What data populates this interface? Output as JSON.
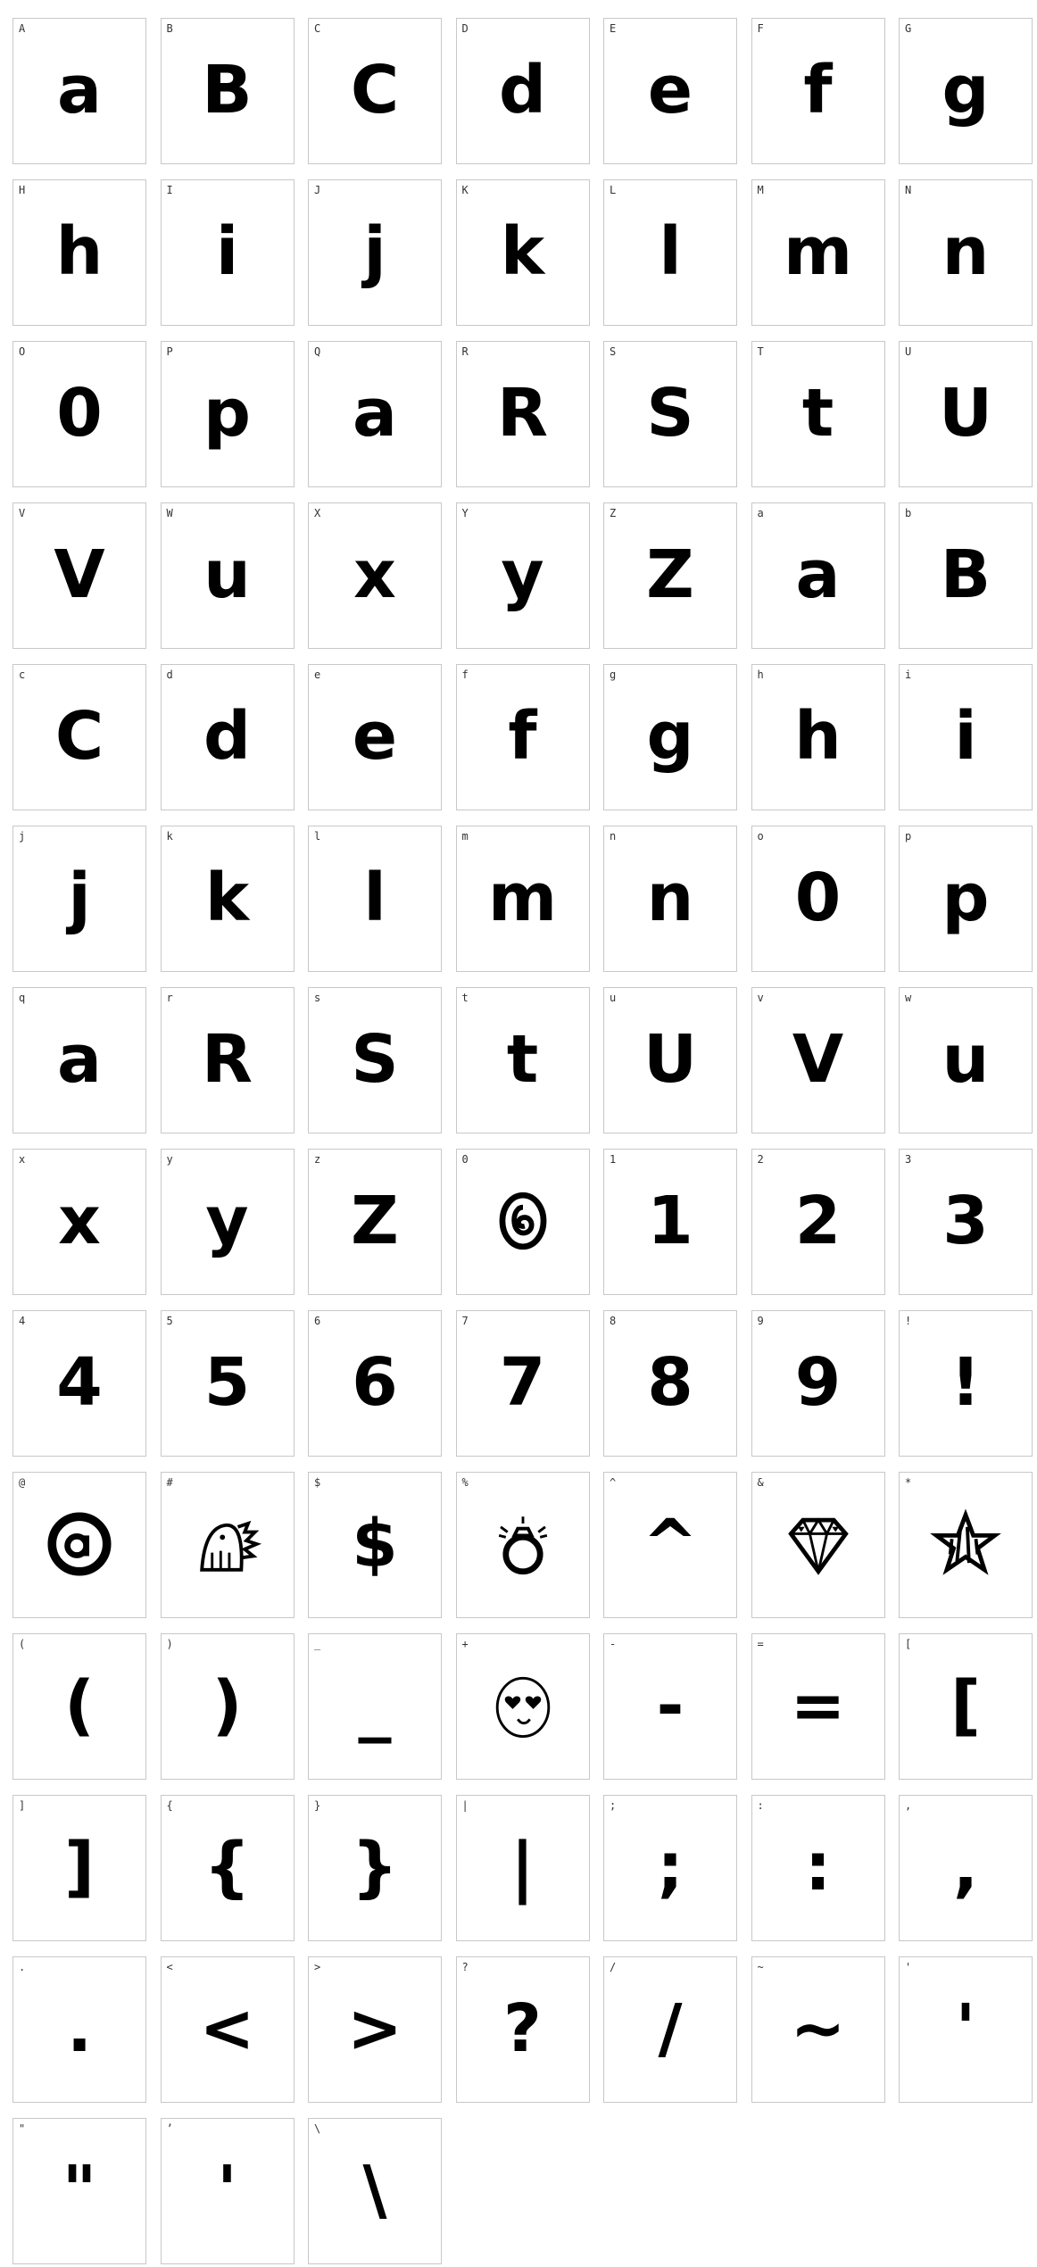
{
  "glyph_color": "#000000",
  "cell_border_color": "#c8c8c8",
  "cells": [
    {
      "label": "A",
      "glyph": "a"
    },
    {
      "label": "B",
      "glyph": "B"
    },
    {
      "label": "C",
      "glyph": "C"
    },
    {
      "label": "D",
      "glyph": "d"
    },
    {
      "label": "E",
      "glyph": "e"
    },
    {
      "label": "F",
      "glyph": "f"
    },
    {
      "label": "G",
      "glyph": "g"
    },
    {
      "label": "H",
      "glyph": "h"
    },
    {
      "label": "I",
      "glyph": "i"
    },
    {
      "label": "J",
      "glyph": "j"
    },
    {
      "label": "K",
      "glyph": "k"
    },
    {
      "label": "L",
      "glyph": "l"
    },
    {
      "label": "M",
      "glyph": "m"
    },
    {
      "label": "N",
      "glyph": "n"
    },
    {
      "label": "O",
      "glyph": "0"
    },
    {
      "label": "P",
      "glyph": "p"
    },
    {
      "label": "Q",
      "glyph": "a"
    },
    {
      "label": "R",
      "glyph": "R"
    },
    {
      "label": "S",
      "glyph": "S"
    },
    {
      "label": "T",
      "glyph": "t"
    },
    {
      "label": "U",
      "glyph": "U"
    },
    {
      "label": "V",
      "glyph": "V"
    },
    {
      "label": "W",
      "glyph": "u"
    },
    {
      "label": "X",
      "glyph": "x"
    },
    {
      "label": "Y",
      "glyph": "y"
    },
    {
      "label": "Z",
      "glyph": "Z"
    },
    {
      "label": "a",
      "glyph": "a"
    },
    {
      "label": "b",
      "glyph": "B"
    },
    {
      "label": "c",
      "glyph": "C"
    },
    {
      "label": "d",
      "glyph": "d"
    },
    {
      "label": "e",
      "glyph": "e"
    },
    {
      "label": "f",
      "glyph": "f"
    },
    {
      "label": "g",
      "glyph": "g"
    },
    {
      "label": "h",
      "glyph": "h"
    },
    {
      "label": "i",
      "glyph": "i"
    },
    {
      "label": "j",
      "glyph": "j"
    },
    {
      "label": "k",
      "glyph": "k"
    },
    {
      "label": "l",
      "glyph": "l"
    },
    {
      "label": "m",
      "glyph": "m"
    },
    {
      "label": "n",
      "glyph": "n"
    },
    {
      "label": "o",
      "glyph": "0"
    },
    {
      "label": "p",
      "glyph": "p"
    },
    {
      "label": "q",
      "glyph": "a"
    },
    {
      "label": "r",
      "glyph": "R"
    },
    {
      "label": "s",
      "glyph": "S"
    },
    {
      "label": "t",
      "glyph": "t"
    },
    {
      "label": "u",
      "glyph": "U"
    },
    {
      "label": "v",
      "glyph": "V"
    },
    {
      "label": "w",
      "glyph": "u"
    },
    {
      "label": "x",
      "glyph": "x"
    },
    {
      "label": "y",
      "glyph": "y"
    },
    {
      "label": "z",
      "glyph": "Z"
    },
    {
      "label": "0",
      "icon": "swirl-zero-icon"
    },
    {
      "label": "1",
      "glyph": "1"
    },
    {
      "label": "2",
      "glyph": "2"
    },
    {
      "label": "3",
      "glyph": "3"
    },
    {
      "label": "4",
      "glyph": "4"
    },
    {
      "label": "5",
      "glyph": "5"
    },
    {
      "label": "6",
      "glyph": "6"
    },
    {
      "label": "7",
      "glyph": "7"
    },
    {
      "label": "8",
      "glyph": "8"
    },
    {
      "label": "9",
      "glyph": "9"
    },
    {
      "label": "!",
      "glyph": "!"
    },
    {
      "label": "@",
      "icon": "circled-a-icon"
    },
    {
      "label": "#",
      "icon": "dinosaur-icon"
    },
    {
      "label": "$",
      "glyph": "$"
    },
    {
      "label": "%",
      "icon": "diamond-ring-icon"
    },
    {
      "label": "^",
      "glyph": "^"
    },
    {
      "label": "&",
      "icon": "diamond-gem-icon"
    },
    {
      "label": "*",
      "icon": "striped-star-icon"
    },
    {
      "label": "(",
      "glyph": "("
    },
    {
      "label": ")",
      "glyph": ")"
    },
    {
      "label": "_",
      "glyph": "_"
    },
    {
      "label": "+",
      "icon": "heart-eyes-face-icon"
    },
    {
      "label": "-",
      "glyph": "-"
    },
    {
      "label": "=",
      "glyph": "="
    },
    {
      "label": "[",
      "glyph": "["
    },
    {
      "label": "]",
      "glyph": "]"
    },
    {
      "label": "{",
      "glyph": "{"
    },
    {
      "label": "}",
      "glyph": "}"
    },
    {
      "label": "|",
      "glyph": "|"
    },
    {
      "label": ";",
      "glyph": ";"
    },
    {
      "label": ":",
      "glyph": ":"
    },
    {
      "label": ",",
      "glyph": ","
    },
    {
      "label": ".",
      "glyph": "."
    },
    {
      "label": "<",
      "glyph": "<"
    },
    {
      "label": ">",
      "glyph": ">"
    },
    {
      "label": "?",
      "glyph": "?"
    },
    {
      "label": "/",
      "glyph": "/"
    },
    {
      "label": "~",
      "glyph": "~"
    },
    {
      "label": "'",
      "glyph": "'"
    },
    {
      "label": "\"",
      "glyph": "\""
    },
    {
      "label": "’",
      "glyph": "'"
    },
    {
      "label": "\\",
      "glyph": "\\"
    }
  ]
}
